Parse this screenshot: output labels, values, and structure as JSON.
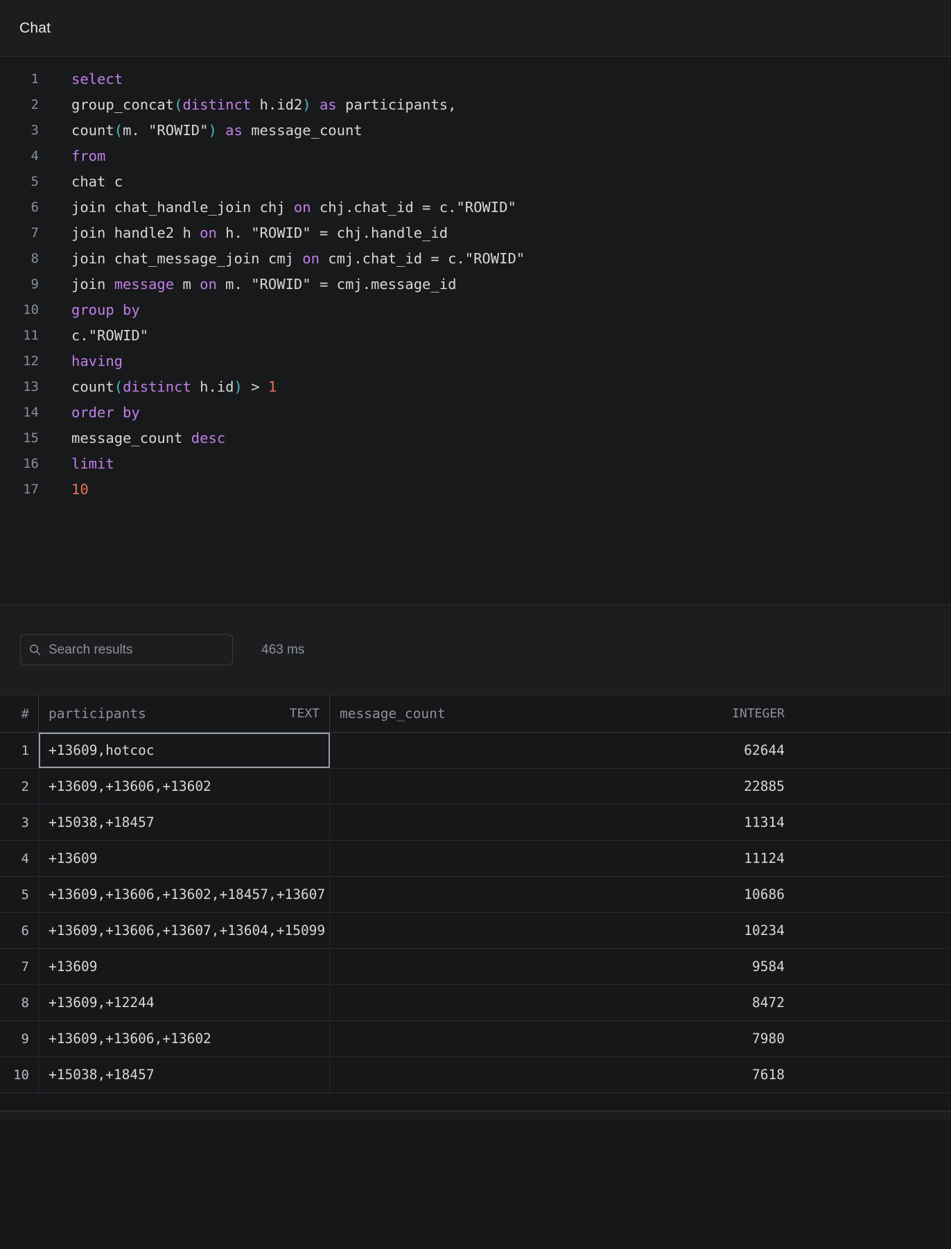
{
  "window": {
    "title": "Chat"
  },
  "editor": {
    "lines": [
      {
        "n": "1",
        "indent": false,
        "tokens": [
          {
            "t": "select",
            "c": "kw"
          }
        ]
      },
      {
        "n": "2",
        "indent": true,
        "tokens": [
          {
            "t": "group_concat",
            "c": "pl"
          },
          {
            "t": "(",
            "c": "punc"
          },
          {
            "t": "distinct",
            "c": "kw"
          },
          {
            "t": " h.id2",
            "c": "pl"
          },
          {
            "t": ")",
            "c": "punc"
          },
          {
            "t": " ",
            "c": "pl"
          },
          {
            "t": "as",
            "c": "kw"
          },
          {
            "t": " participants,",
            "c": "pl"
          }
        ]
      },
      {
        "n": "3",
        "indent": true,
        "tokens": [
          {
            "t": "count",
            "c": "pl"
          },
          {
            "t": "(",
            "c": "punc"
          },
          {
            "t": "m. \"ROWID\"",
            "c": "pl"
          },
          {
            "t": ")",
            "c": "punc"
          },
          {
            "t": " ",
            "c": "pl"
          },
          {
            "t": "as",
            "c": "kw"
          },
          {
            "t": " message_count",
            "c": "pl"
          }
        ]
      },
      {
        "n": "4",
        "indent": false,
        "tokens": [
          {
            "t": "from",
            "c": "kw"
          }
        ]
      },
      {
        "n": "5",
        "indent": true,
        "tokens": [
          {
            "t": "chat c",
            "c": "pl"
          }
        ]
      },
      {
        "n": "6",
        "indent": true,
        "tokens": [
          {
            "t": "join chat_handle_join chj ",
            "c": "pl"
          },
          {
            "t": "on",
            "c": "kw"
          },
          {
            "t": " chj.chat_id = c.\"ROWID\"",
            "c": "pl"
          }
        ]
      },
      {
        "n": "7",
        "indent": true,
        "tokens": [
          {
            "t": "join handle2 h ",
            "c": "pl"
          },
          {
            "t": "on",
            "c": "kw"
          },
          {
            "t": " h. \"ROWID\" = chj.handle_id",
            "c": "pl"
          }
        ]
      },
      {
        "n": "8",
        "indent": true,
        "tokens": [
          {
            "t": "join chat_message_join cmj ",
            "c": "pl"
          },
          {
            "t": "on",
            "c": "kw"
          },
          {
            "t": " cmj.chat_id = c.\"ROWID\"",
            "c": "pl"
          }
        ]
      },
      {
        "n": "9",
        "indent": true,
        "tokens": [
          {
            "t": "join ",
            "c": "pl"
          },
          {
            "t": "message",
            "c": "kw"
          },
          {
            "t": " m ",
            "c": "pl"
          },
          {
            "t": "on",
            "c": "kw"
          },
          {
            "t": " m. \"ROWID\" = cmj.message_id",
            "c": "pl"
          }
        ]
      },
      {
        "n": "10",
        "indent": false,
        "tokens": [
          {
            "t": "group by",
            "c": "kw"
          }
        ]
      },
      {
        "n": "11",
        "indent": true,
        "tokens": [
          {
            "t": "c.\"ROWID\"",
            "c": "pl"
          }
        ]
      },
      {
        "n": "12",
        "indent": false,
        "tokens": [
          {
            "t": "having",
            "c": "kw"
          }
        ]
      },
      {
        "n": "13",
        "indent": true,
        "tokens": [
          {
            "t": "count",
            "c": "pl"
          },
          {
            "t": "(",
            "c": "punc"
          },
          {
            "t": "distinct",
            "c": "kw"
          },
          {
            "t": " h.id",
            "c": "pl"
          },
          {
            "t": ")",
            "c": "punc"
          },
          {
            "t": " > ",
            "c": "pl"
          },
          {
            "t": "1",
            "c": "num"
          }
        ]
      },
      {
        "n": "14",
        "indent": false,
        "tokens": [
          {
            "t": "order by",
            "c": "kw"
          }
        ]
      },
      {
        "n": "15",
        "indent": true,
        "tokens": [
          {
            "t": "message_count ",
            "c": "pl"
          },
          {
            "t": "desc",
            "c": "kw"
          }
        ]
      },
      {
        "n": "16",
        "indent": false,
        "tokens": [
          {
            "t": "limit",
            "c": "kw"
          }
        ]
      },
      {
        "n": "17",
        "indent": true,
        "tokens": [
          {
            "t": "10",
            "c": "num"
          }
        ]
      }
    ]
  },
  "results": {
    "search_placeholder": "Search results",
    "timing": "463 ms",
    "columns": [
      {
        "name": "participants",
        "type": "TEXT"
      },
      {
        "name": "message_count",
        "type": "INTEGER"
      }
    ],
    "index_header": "#",
    "rows": [
      {
        "i": "1",
        "participants": "+13609,hotcoc",
        "message_count": "62644",
        "selected": true
      },
      {
        "i": "2",
        "participants": "+13609,+13606,+13602",
        "message_count": "22885",
        "selected": false
      },
      {
        "i": "3",
        "participants": "+15038,+18457",
        "message_count": "11314",
        "selected": false
      },
      {
        "i": "4",
        "participants": "+13609",
        "message_count": "11124",
        "selected": false
      },
      {
        "i": "5",
        "participants": "+13609,+13606,+13602,+18457,+13607",
        "message_count": "10686",
        "selected": false
      },
      {
        "i": "6",
        "participants": "+13609,+13606,+13607,+13604,+15099",
        "message_count": "10234",
        "selected": false
      },
      {
        "i": "7",
        "participants": "+13609",
        "message_count": "9584",
        "selected": false
      },
      {
        "i": "8",
        "participants": "+13609,+12244",
        "message_count": "8472",
        "selected": false
      },
      {
        "i": "9",
        "participants": "+13609,+13606,+13602",
        "message_count": "7980",
        "selected": false
      },
      {
        "i": "10",
        "participants": "+15038,+18457",
        "message_count": "7618",
        "selected": false
      }
    ]
  }
}
